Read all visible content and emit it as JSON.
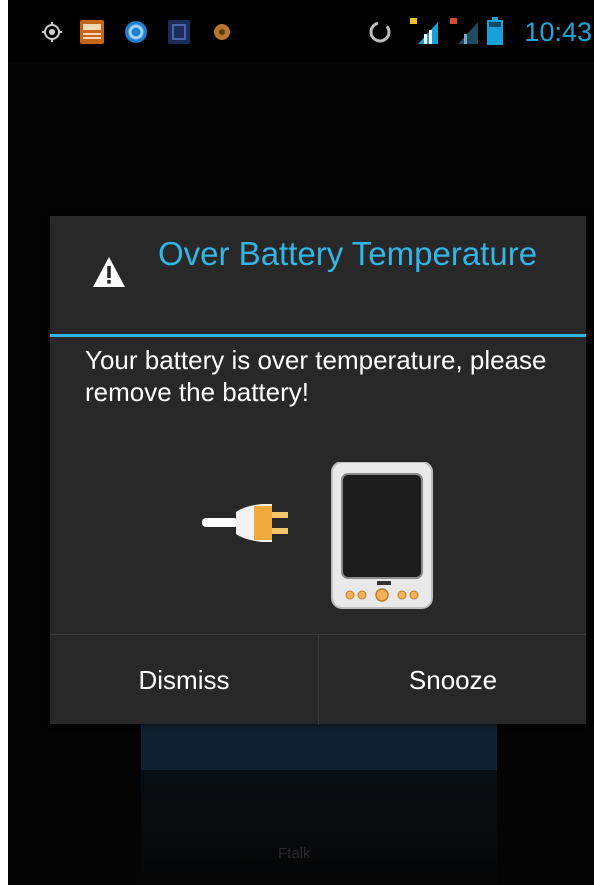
{
  "status_bar": {
    "time": "10:43",
    "left_icons": [
      "location-icon",
      "news-app-icon",
      "browser-icon",
      "parking-app-icon",
      "settings-app-icon"
    ],
    "right_icons": [
      "sync-icon",
      "signal-icon",
      "signal-2-icon",
      "battery-icon"
    ],
    "accent": "#1aa8d8"
  },
  "dialog": {
    "title": "Over Battery Temperature",
    "message": "Your battery is over temperature, please remove the battery!",
    "accent": "#33b5e5",
    "buttons": {
      "dismiss": "Dismiss",
      "snooze": "Snooze"
    }
  },
  "background": {
    "partial_text": "Ftalk"
  }
}
